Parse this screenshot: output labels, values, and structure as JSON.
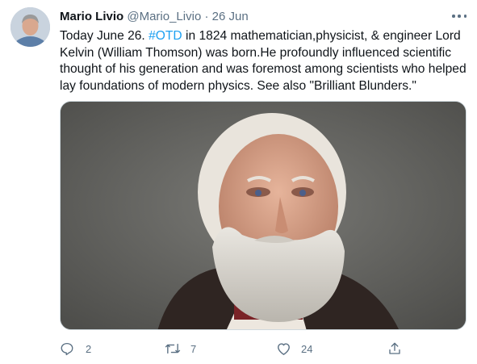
{
  "tweet": {
    "author_name": "Mario Livio",
    "author_handle": "@Mario_Livio",
    "separator": "·",
    "date": "26 Jun",
    "text_before": "Today June 26. ",
    "hashtag": "#OTD",
    "text_after": " in 1824 mathematician,physicist, & engineer Lord Kelvin (William Thomson) was born.He profoundly influenced scientific thought of his generation and was foremost among scientists who helped lay foundations of modern physics. See also \"Brilliant Blunders.\""
  },
  "actions": {
    "reply": {
      "icon": "reply-icon",
      "count": "2"
    },
    "retweet": {
      "icon": "retweet-icon",
      "count": "7"
    },
    "like": {
      "icon": "heart-icon",
      "count": "24"
    },
    "share": {
      "icon": "share-icon"
    }
  },
  "colors": {
    "link": "#1da1f2",
    "secondary_text": "#5b7083",
    "primary_text": "#0f1419"
  }
}
